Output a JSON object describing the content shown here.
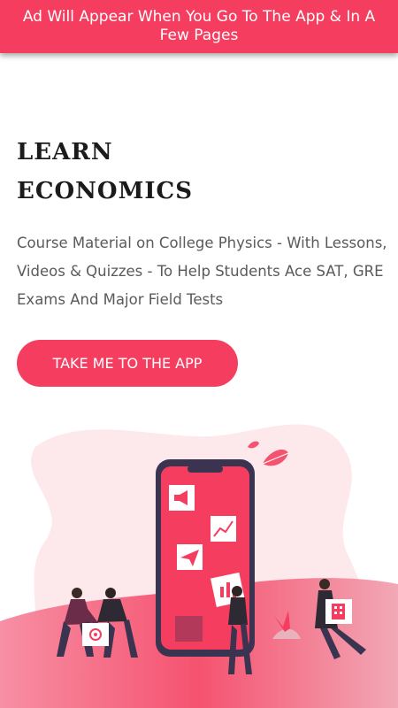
{
  "ad_banner": {
    "text": "Ad Will Appear When You Go To The App & In A Few Pages"
  },
  "hero": {
    "title_line1": "LEARN",
    "title_line2": "ECONOMICS",
    "description": "Course Material on College Physics - With Lessons, Videos & Quizzes - To Help Students Ace SAT, GRE Exams And Major Field Tests"
  },
  "cta": {
    "label": "TAKE ME TO THE APP"
  },
  "illustration": {
    "icons": [
      "megaphone-icon",
      "chart-icon",
      "paper-plane-icon",
      "bar-chart-icon",
      "at-sign-icon",
      "building-icon",
      "leaf-icon"
    ],
    "colors": {
      "accent": "#f53d5f",
      "phone_frame": "#3a3450",
      "blob": "#fde8ec"
    }
  }
}
